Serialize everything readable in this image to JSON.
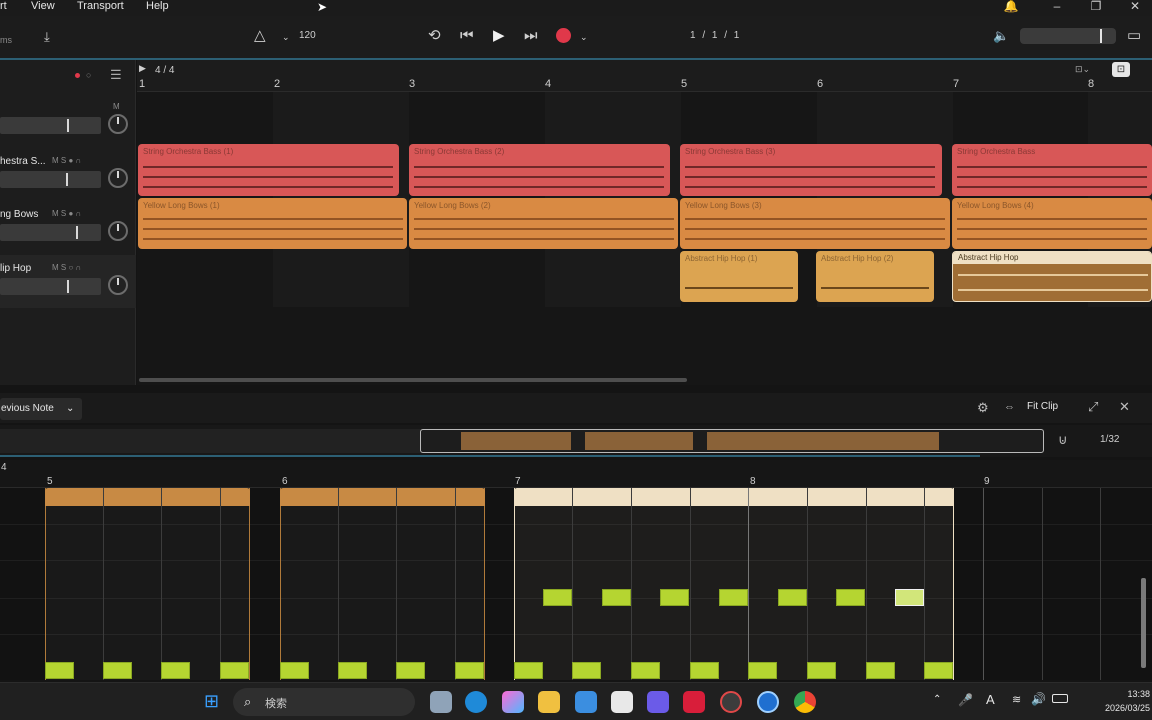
{
  "menu": {
    "items": [
      "View",
      "Transport",
      "Help"
    ],
    "partial_left": "rt"
  },
  "toolbar": {
    "partial_left_label": "ms",
    "tempo": "120",
    "position": "1 / 1 / 1"
  },
  "arrangement": {
    "time_signature": "4 / 4",
    "bar_numbers": [
      "1",
      "2",
      "3",
      "4",
      "5",
      "6",
      "7",
      "8"
    ],
    "tracks": [
      {
        "name": "",
        "buttons": "M"
      },
      {
        "name": "hestra S...",
        "buttons": "M S ● ∩"
      },
      {
        "name": "ng Bows",
        "buttons": "M S ● ∩"
      },
      {
        "name": "lip Hop",
        "buttons": "M S ○ ∩"
      }
    ],
    "clips": [
      {
        "title": "String Orchestra Bass (1)",
        "color": "#d85757"
      },
      {
        "title": "String Orchestra Bass (2)",
        "color": "#d85757"
      },
      {
        "title": "String Orchestra Bass (3)",
        "color": "#d85757"
      },
      {
        "title": "String Orchestra Bass",
        "color": "#d85757"
      },
      {
        "title": "Yellow Long Bows (1)",
        "color": "#d98a43"
      },
      {
        "title": "Yellow Long Bows (2)",
        "color": "#d98a43"
      },
      {
        "title": "Yellow Long Bows (3)",
        "color": "#d98a43"
      },
      {
        "title": "Yellow Long Bows (4)",
        "color": "#d98a43"
      },
      {
        "title": "Abstract Hip Hop (1)",
        "color": "#dca451"
      },
      {
        "title": "Abstract Hip Hop (2)",
        "color": "#dca451"
      },
      {
        "title": "Abstract Hip Hop",
        "color": "#efe0c4"
      }
    ]
  },
  "editor": {
    "preset_label": "evious Note",
    "fit_clip_label": "Fit Clip",
    "quantize": "1/32",
    "ruler_numbers": [
      "4",
      "5",
      "6",
      "7",
      "8",
      "9"
    ]
  },
  "taskbar": {
    "search_placeholder": "検索",
    "time": "13:38",
    "date": "2026/03/25"
  },
  "colors": {
    "accent_record": "#e0384a",
    "note": "#b5d531",
    "clip_red": "#d85757",
    "clip_orange": "#d98a43"
  }
}
